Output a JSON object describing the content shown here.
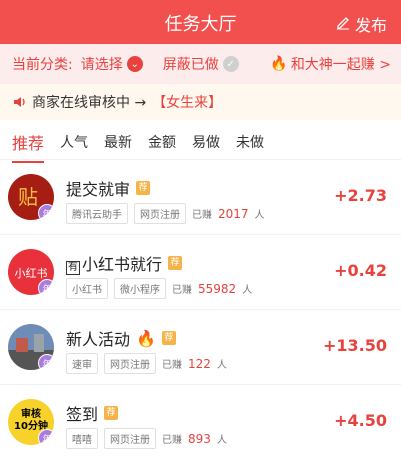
{
  "header": {
    "title": "任务大厅",
    "publish_label": "发布"
  },
  "filter": {
    "label": "当前分类:",
    "select": "请选择",
    "hidden": "屏蔽已做",
    "promo": "和大神一起赚 >"
  },
  "notice": {
    "text": "商家在线审核中 →",
    "tag": "【女生来】"
  },
  "tabs": [
    {
      "label": "推荐"
    },
    {
      "label": "人气"
    },
    {
      "label": "最新"
    },
    {
      "label": "金额"
    },
    {
      "label": "易做"
    },
    {
      "label": "未做"
    }
  ],
  "items": [
    {
      "title": "提交就审",
      "tags": [
        "腾讯云助手",
        "网页注册"
      ],
      "earned_prefix": "已赚",
      "earned_count": "2017",
      "earned_suffix": "人",
      "price": "+2.73",
      "avatar_text": "",
      "avatar_bg": "#a61d13",
      "badge": "年"
    },
    {
      "title": "小红书就行",
      "title_prefix": "有",
      "tags": [
        "小红书",
        "微小程序"
      ],
      "earned_prefix": "已赚",
      "earned_count": "55982",
      "earned_suffix": "人",
      "price": "+0.42",
      "avatar_text": "小红书",
      "avatar_bg": "#e8313a",
      "badge": "年"
    },
    {
      "title": "新人活动",
      "title_emoji": "🔥",
      "tags": [
        "速审",
        "网页注册"
      ],
      "earned_prefix": "已赚",
      "earned_count": "122",
      "earned_suffix": "人",
      "price": "+13.50",
      "avatar_text": "",
      "avatar_bg": "#6e8cb5",
      "badge": "年"
    },
    {
      "title": "签到",
      "tags": [
        "嘻嘻",
        "网页注册"
      ],
      "earned_prefix": "已赚",
      "earned_count": "893",
      "earned_suffix": "人",
      "price": "+4.50",
      "avatar_text": "审核\n10分钟",
      "avatar_bg": "#f6d22b",
      "badge": "年"
    }
  ],
  "labels": {
    "recommend_tag": "荐"
  }
}
